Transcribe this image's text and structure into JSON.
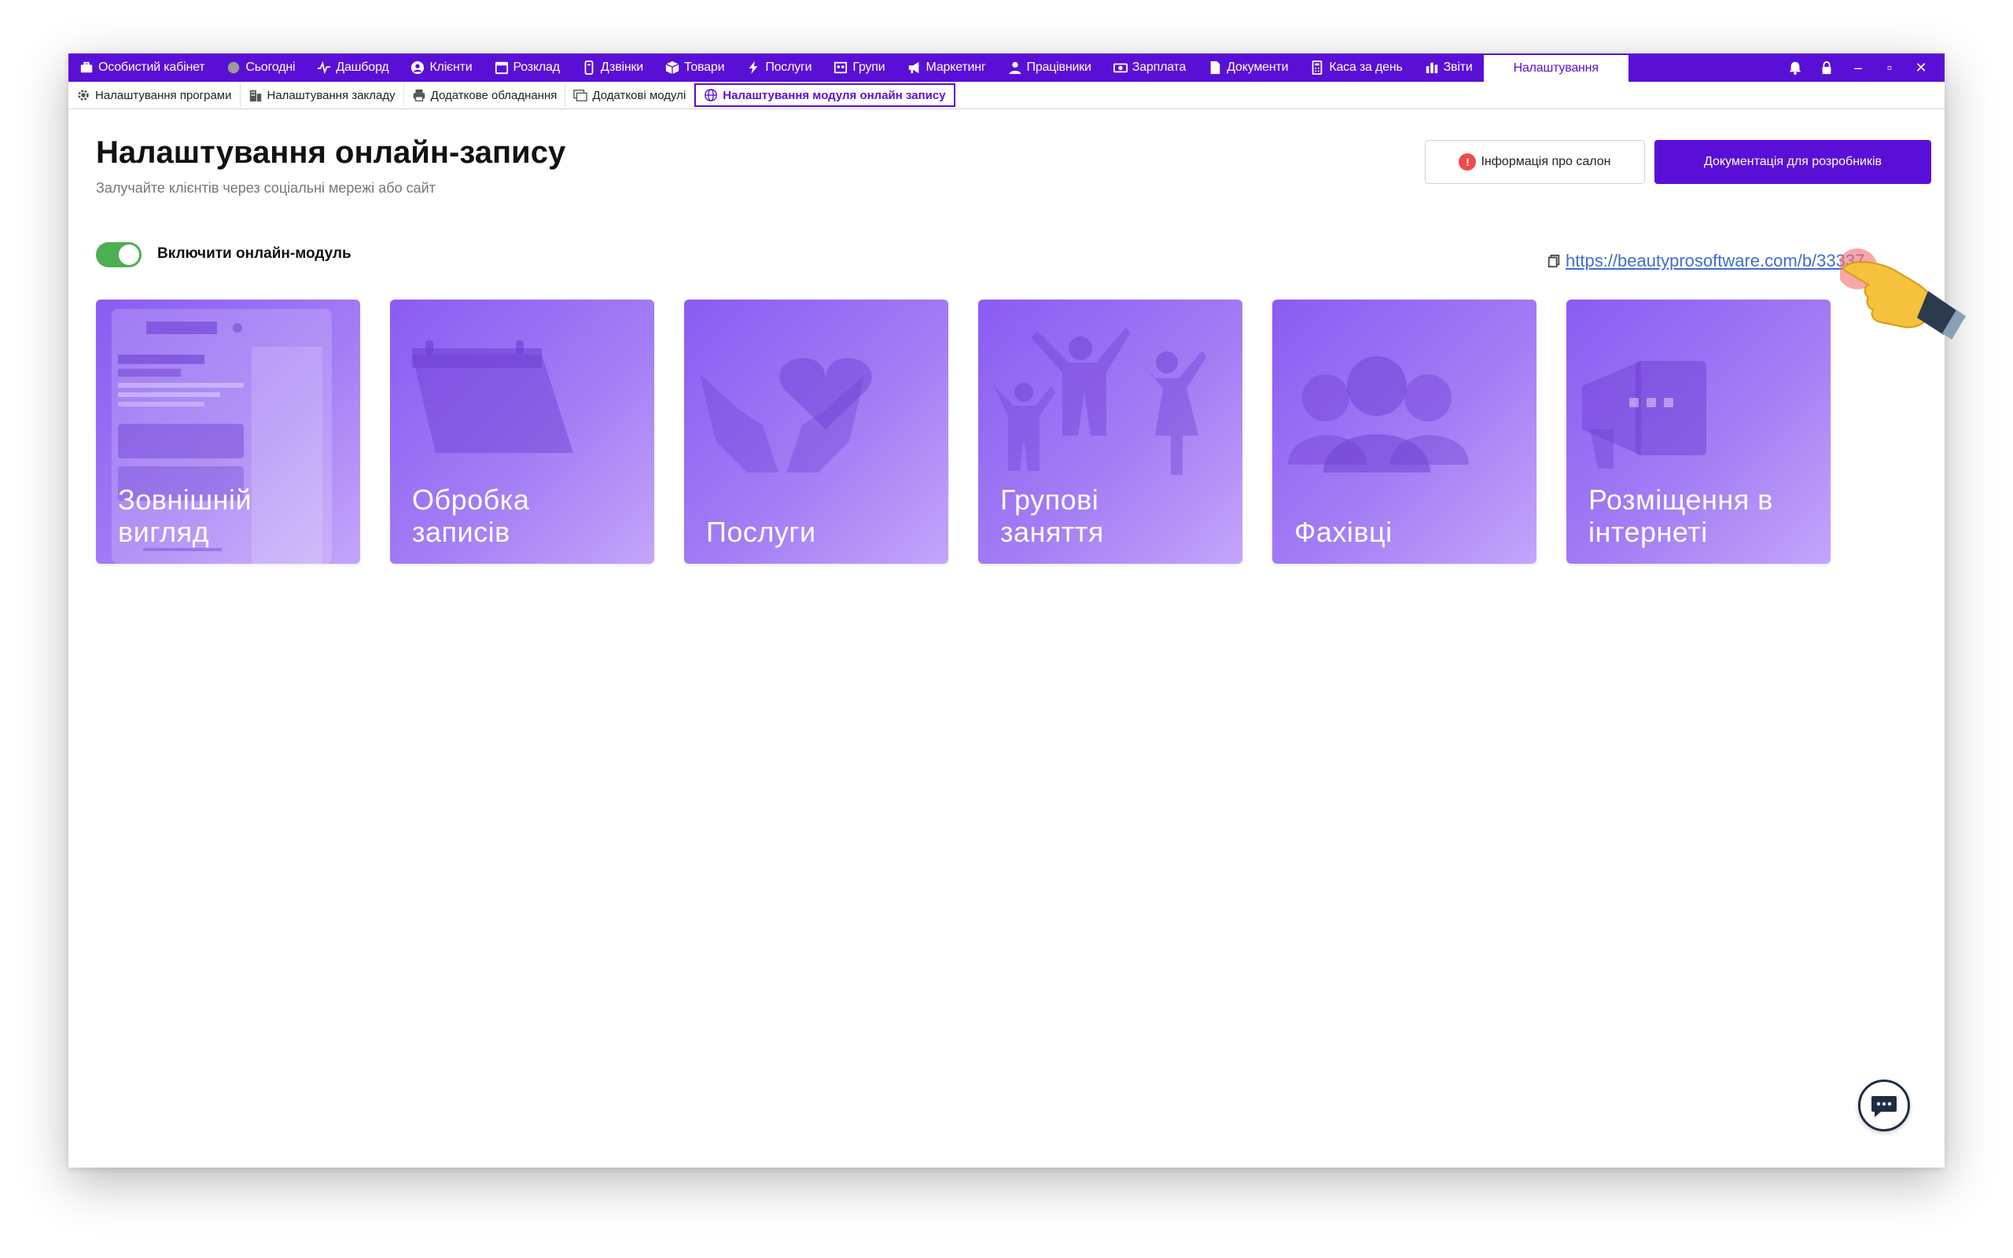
{
  "topnav": {
    "items": [
      {
        "label": "Особистий кабінет",
        "icon": "briefcase-icon"
      },
      {
        "label": "Сьогодні",
        "icon": "clock-icon"
      },
      {
        "label": "Дашборд",
        "icon": "pulse-icon"
      },
      {
        "label": "Клієнти",
        "icon": "user-circle-icon"
      },
      {
        "label": "Розклад",
        "icon": "calendar-icon"
      },
      {
        "label": "Дзвінки",
        "icon": "phone-icon"
      },
      {
        "label": "Товари",
        "icon": "box-icon"
      },
      {
        "label": "Послуги",
        "icon": "lightning-icon"
      },
      {
        "label": "Групи",
        "icon": "group-icon"
      },
      {
        "label": "Маркетинг",
        "icon": "megaphone-icon"
      },
      {
        "label": "Працівники",
        "icon": "person-icon"
      },
      {
        "label": "Зарплата",
        "icon": "money-icon"
      },
      {
        "label": "Документи",
        "icon": "document-icon"
      },
      {
        "label": "Каса за день",
        "icon": "calculator-icon"
      },
      {
        "label": "Звіти",
        "icon": "bar-chart-icon"
      }
    ],
    "active_label": "Налаштування"
  },
  "window_controls": {
    "minimize": "–",
    "maximize": "▫",
    "close": "✕"
  },
  "subtabs": [
    {
      "label": "Налаштування програми",
      "icon": "gear-icon"
    },
    {
      "label": "Налаштування закладу",
      "icon": "building-icon"
    },
    {
      "label": "Додаткове обладнання",
      "icon": "printer-icon"
    },
    {
      "label": "Додаткові модулі",
      "icon": "modules-icon"
    },
    {
      "label": "Налаштування модуля онлайн запису",
      "icon": "globe-icon",
      "active": true
    }
  ],
  "page": {
    "title": "Налаштування онлайн-запису",
    "subtitle": "Залучайте клієнтів через соціальні мережі або сайт",
    "info_button": "Інформація про салон",
    "info_badge": "!",
    "docs_button": "Документація для розробників",
    "toggle_label": "Включити онлайн-модуль",
    "toggle_on": true,
    "link": "https://beautyprosoftware.com/b/33337"
  },
  "cards": [
    {
      "label": "Зовнішній\nвигляд",
      "icon": "phone-mockup-icon"
    },
    {
      "label": "Обробка\nзаписів",
      "icon": "calendar-icon"
    },
    {
      "label": "Послуги",
      "icon": "heart-hands-icon"
    },
    {
      "label": "Групові\nзаняття",
      "icon": "group-dance-icon"
    },
    {
      "label": "Фахівці",
      "icon": "people-icon"
    },
    {
      "label": "Розміщення в\nінтернеті",
      "icon": "megaphone-icon"
    }
  ],
  "colors": {
    "brand": "#5a0fd6",
    "toggle": "#4caf50",
    "link": "#3f6ecf",
    "badge": "#ef4b4b"
  }
}
